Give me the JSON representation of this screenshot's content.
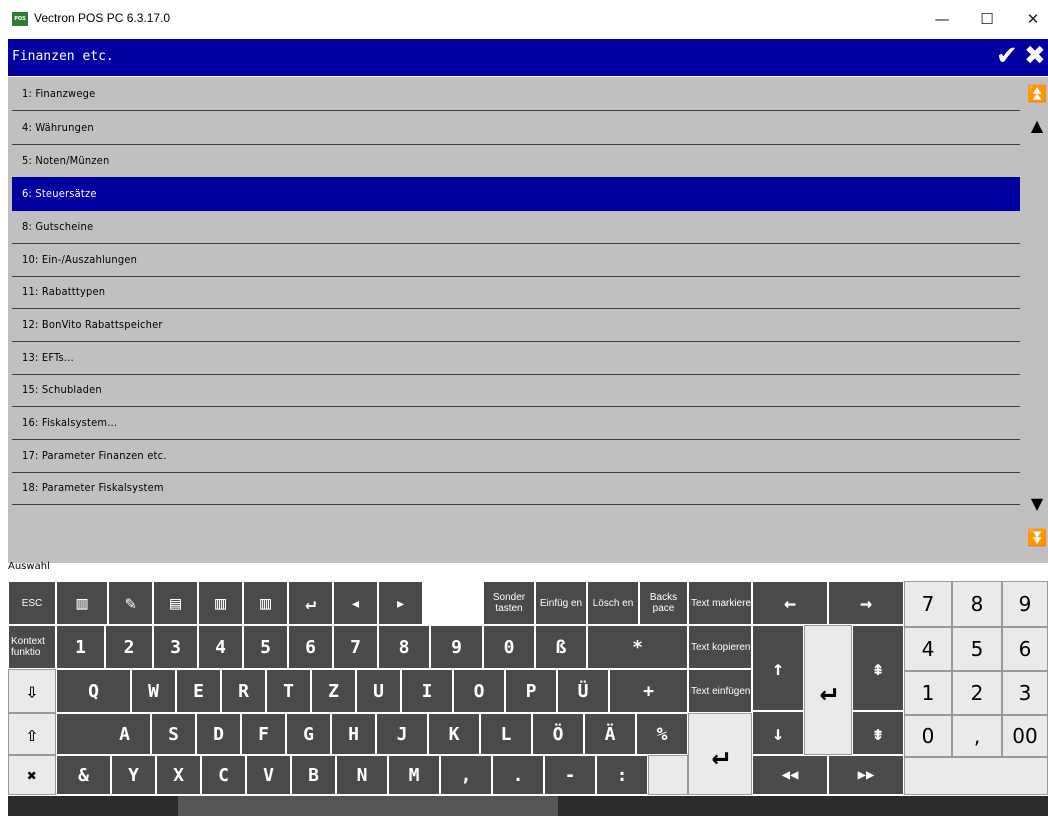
{
  "window": {
    "title": "Vectron POS PC 6.3.17.0",
    "icon_label": "POS",
    "minimize": "—",
    "maximize": "☐",
    "close": "✕"
  },
  "header": {
    "title": "Finanzen etc.",
    "ok_icon": "✔",
    "cancel_icon": "✖"
  },
  "list": {
    "items": [
      {
        "label": "1: Finanzwege",
        "selected": false
      },
      {
        "label": "4: Währungen",
        "selected": false
      },
      {
        "label": "5: Noten/Münzen",
        "selected": false
      },
      {
        "label": "6: Steuersätze",
        "selected": true
      },
      {
        "label": "8: Gutscheine",
        "selected": false
      },
      {
        "label": "10: Ein-/Auszahlungen",
        "selected": false
      },
      {
        "label": "11: Rabatttypen",
        "selected": false
      },
      {
        "label": "12: BonVito Rabattspeicher",
        "selected": false
      },
      {
        "label": "13: EFTs...",
        "selected": false
      },
      {
        "label": "15: Schubladen",
        "selected": false
      },
      {
        "label": "16: Fiskalsystem...",
        "selected": false
      },
      {
        "label": "17: Parameter Finanzen etc.",
        "selected": false
      },
      {
        "label": "18: Parameter Fiskalsystem",
        "selected": false
      }
    ],
    "scroll_top": "⏫",
    "scroll_up": "▲",
    "scroll_down": "▼",
    "scroll_bottom": "⏬"
  },
  "status": {
    "auswahl": "Auswahl"
  },
  "keyboard": {
    "esc": "ESC",
    "sonder": "Sonder tasten",
    "einfuegen": "Einfüg en",
    "loeschen": "Lösch en",
    "backspace": "Backs pace",
    "text_markieren": "Text markiere",
    "text_kopieren": "Text kopieren",
    "text_einfuegen": "Text einfügen",
    "kontext": "Kontext funktio",
    "row1": [
      "1",
      "2",
      "3",
      "4",
      "5",
      "6",
      "7",
      "8",
      "9",
      "0",
      "ß",
      "*"
    ],
    "row2": [
      "Q",
      "W",
      "E",
      "R",
      "T",
      "Z",
      "U",
      "I",
      "O",
      "P",
      "Ü",
      "+"
    ],
    "row3": [
      "A",
      "S",
      "D",
      "F",
      "G",
      "H",
      "J",
      "K",
      "L",
      "Ö",
      "Ä",
      "%"
    ],
    "row4": [
      "&",
      "Y",
      "X",
      "C",
      "V",
      "B",
      "N",
      "M",
      ",",
      ".",
      "-",
      ":"
    ],
    "numpad": [
      "7",
      "8",
      "9",
      "4",
      "5",
      "6",
      "1",
      "2",
      "3",
      "0",
      ",",
      "00"
    ],
    "arrow_left": "←",
    "arrow_right": "→",
    "arrow_up": "↑",
    "arrow_down": "↓",
    "page_up": "⇞",
    "page_down": "⇟",
    "rewind": "◀◀",
    "forward": "▶▶",
    "enter": "↵",
    "shift": "⇧",
    "caps_down": "⇩",
    "no_shift": "✖"
  },
  "colors": {
    "header_bg": "#0000a0",
    "list_bg": "#c0c0c0",
    "key_dark": "#4a4a4a",
    "key_light": "#eaeaea"
  }
}
